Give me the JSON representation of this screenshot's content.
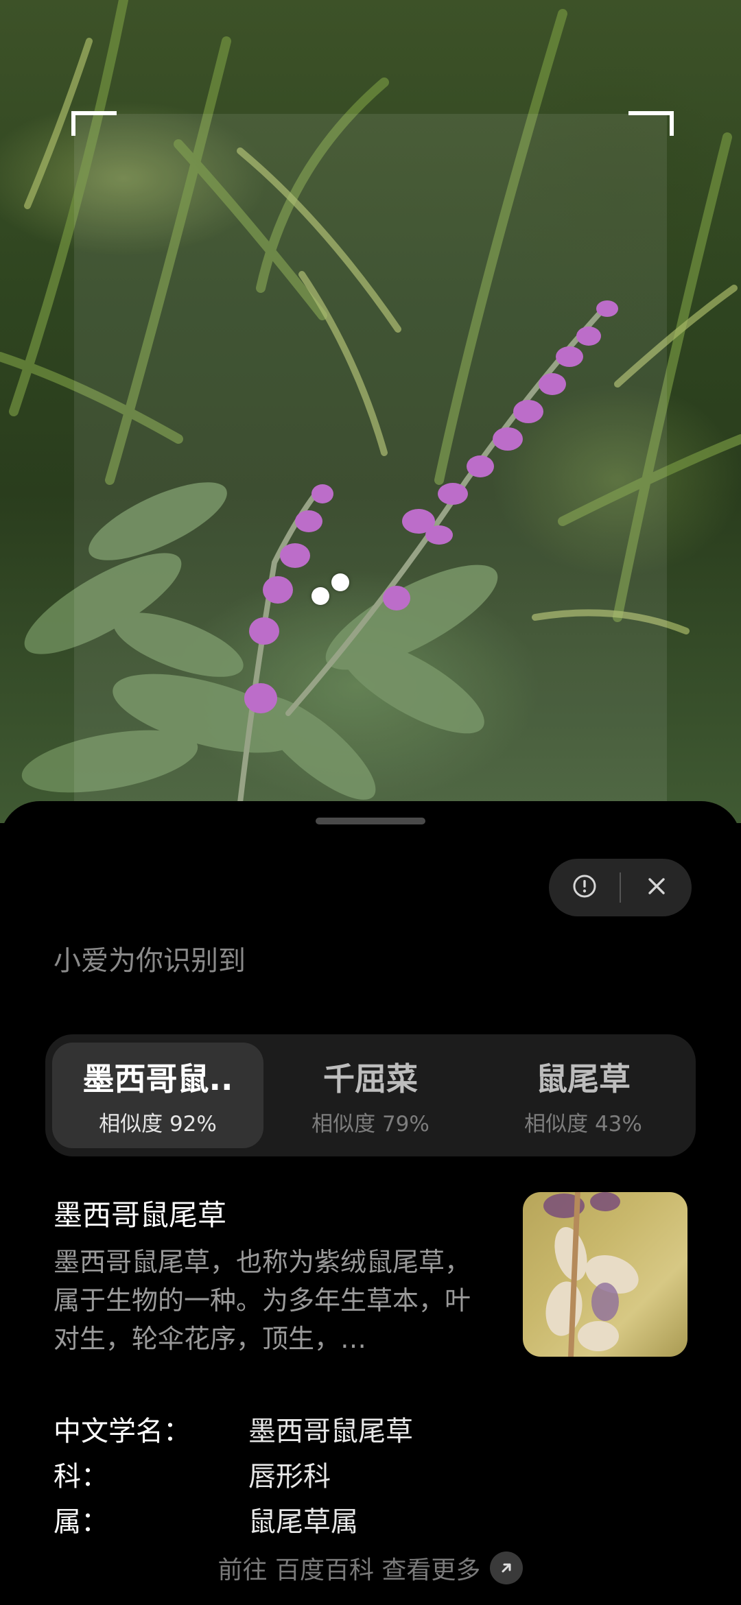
{
  "header": {
    "recognized_label": "小爱为你识别到"
  },
  "candidates": [
    {
      "name": "墨西哥鼠..",
      "similarity": "相似度 92%",
      "selected": true
    },
    {
      "name": "千屈菜",
      "similarity": "相似度 79%",
      "selected": false
    },
    {
      "name": "鼠尾草",
      "similarity": "相似度 43%",
      "selected": false
    }
  ],
  "detail": {
    "title": "墨西哥鼠尾草",
    "description": "墨西哥鼠尾草，也称为紫绒鼠尾草，属于生物的一种。为多年生草本，叶对生，轮伞花序，顶生，…",
    "fields": [
      {
        "label": "中文学名：",
        "value": "墨西哥鼠尾草"
      },
      {
        "label": "科：",
        "value": "唇形科"
      },
      {
        "label": "属：",
        "value": "鼠尾草属"
      }
    ]
  },
  "footer": {
    "more_link": "前往 百度百科 查看更多"
  },
  "icons": {
    "report": "exclamation-circle-icon",
    "close": "close-icon",
    "link": "arrow-up-right-icon"
  }
}
